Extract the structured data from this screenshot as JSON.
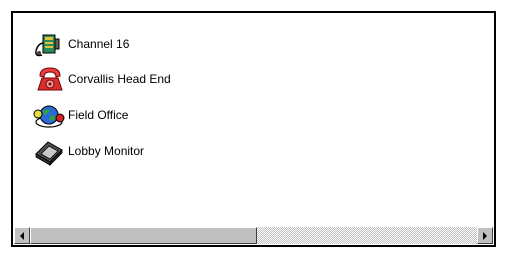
{
  "list": {
    "items": [
      {
        "label": "Channel 16",
        "icon": "channel-transmitter-icon"
      },
      {
        "label": "Corvallis Head End",
        "icon": "red-telephone-icon"
      },
      {
        "label": "Field Office",
        "icon": "globe-network-icon"
      },
      {
        "label": "Lobby Monitor",
        "icon": "monitor-display-icon"
      }
    ]
  },
  "scrollbar": {
    "left_icon": "scroll-left-arrow-icon",
    "right_icon": "scroll-right-arrow-icon",
    "position": 0.0
  },
  "colors": {
    "frame": "#000000",
    "scrollbar_face": "#c0c0c0",
    "background": "#ffffff"
  }
}
